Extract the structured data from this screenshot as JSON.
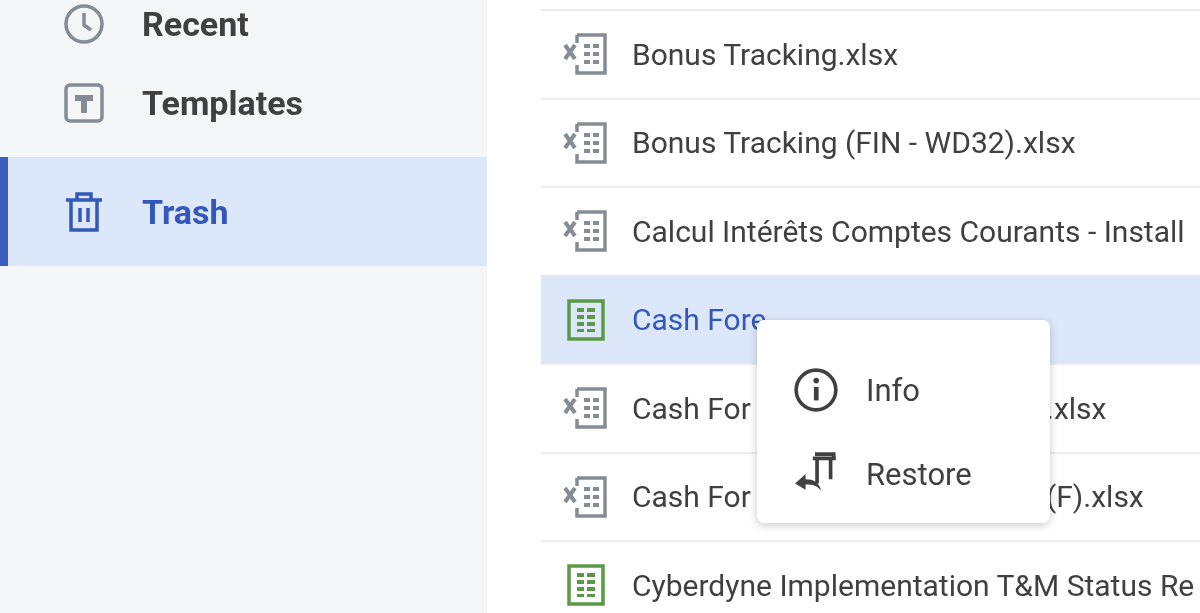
{
  "sidebar": {
    "items": [
      {
        "label": "Recent",
        "selected": false
      },
      {
        "label": "Templates",
        "selected": false
      },
      {
        "label": "Trash",
        "selected": true
      }
    ]
  },
  "files": [
    {
      "name": "Bonus Tracking.xlsx",
      "kind": "excel",
      "selected": false
    },
    {
      "name": "Bonus Tracking (FIN - WD32).xlsx",
      "kind": "excel",
      "selected": false
    },
    {
      "name": "Calcul Intérêts Comptes Courants - Install",
      "kind": "excel",
      "selected": false
    },
    {
      "name": "Cash Fore",
      "kind": "sheet",
      "selected": true
    },
    {
      "name": "Cash For",
      "name_end": ".xlsx",
      "kind": "excel",
      "selected": false
    },
    {
      "name": "Cash For",
      "name_end": "(F).xlsx",
      "kind": "excel",
      "selected": false
    },
    {
      "name": "Cyberdyne Implementation T&M Status Re",
      "kind": "sheet",
      "selected": false
    }
  ],
  "context_menu": {
    "items": [
      {
        "label": "Info"
      },
      {
        "label": "Restore"
      }
    ]
  }
}
